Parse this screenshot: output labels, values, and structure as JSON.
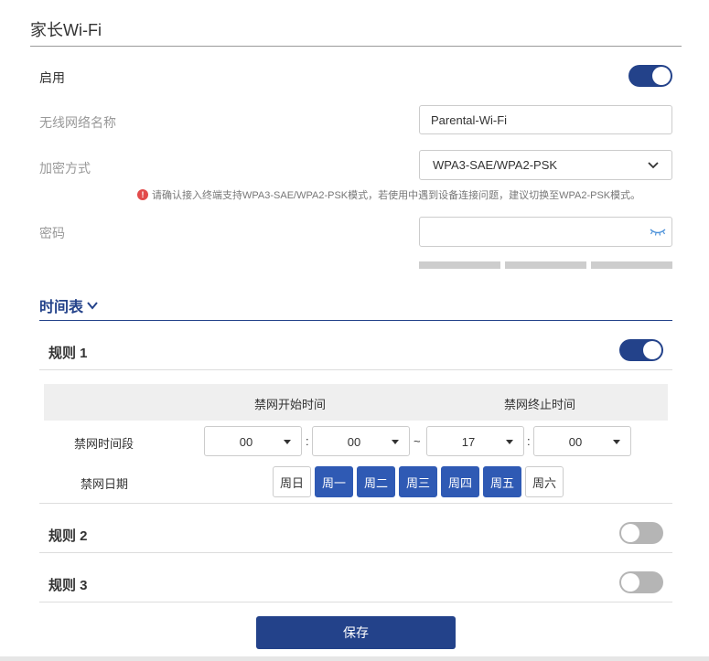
{
  "page": {
    "title": "家长Wi-Fi"
  },
  "colors": {
    "accent": "#23428a",
    "day_active": "#2f5ab4",
    "toggle_off": "#b5b5b5",
    "warning": "#e24b4b"
  },
  "form": {
    "enable_label": "启用",
    "enable_on": true,
    "ssid_label": "无线网络名称",
    "ssid_value": "Parental-Wi-Fi",
    "encryption_label": "加密方式",
    "encryption_value": "WPA3-SAE/WPA2-PSK",
    "warning_text": "请确认接入终端支持WPA3-SAE/WPA2-PSK模式，若使用中遇到设备连接问题，建议切换至WPA2-PSK模式。",
    "password_label": "密码",
    "password_value": "",
    "password_icon": "eye-closed-icon"
  },
  "schedule": {
    "header": "时间表",
    "rules": [
      {
        "title": "规则 1",
        "enabled": true,
        "col_start": "禁网开始时间",
        "col_end": "禁网终止时间",
        "period_label": "禁网时间段",
        "start_hour": "00",
        "start_minute": "00",
        "end_hour": "17",
        "end_minute": "00",
        "colon": ":",
        "tilde": "~",
        "days_label": "禁网日期",
        "days": [
          {
            "label": "周日",
            "selected": false
          },
          {
            "label": "周一",
            "selected": true
          },
          {
            "label": "周二",
            "selected": true
          },
          {
            "label": "周三",
            "selected": true
          },
          {
            "label": "周四",
            "selected": true
          },
          {
            "label": "周五",
            "selected": true
          },
          {
            "label": "周六",
            "selected": false
          }
        ]
      },
      {
        "title": "规则 2",
        "enabled": false
      },
      {
        "title": "规则 3",
        "enabled": false
      }
    ]
  },
  "actions": {
    "save_label": "保存"
  }
}
